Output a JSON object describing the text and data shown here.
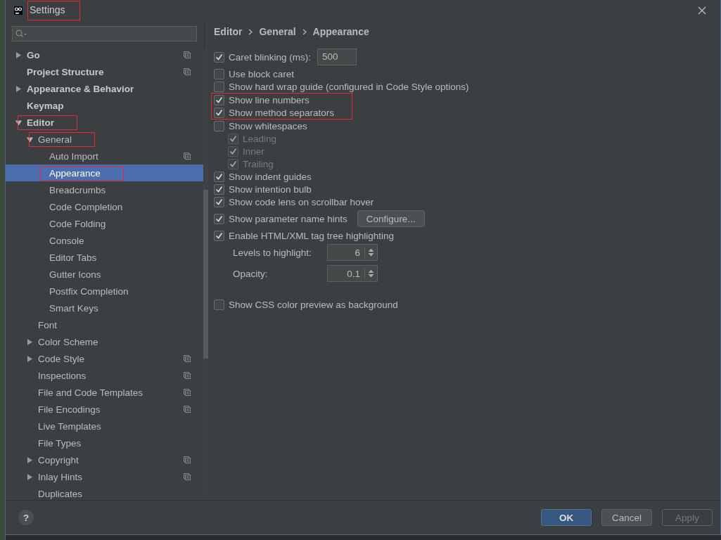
{
  "window": {
    "title": "Settings",
    "title_marked": true
  },
  "tree": [
    {
      "label": "Go",
      "expanded": false,
      "project_level": true
    },
    {
      "label": "Project Structure",
      "project_level": true
    },
    {
      "label": "Appearance & Behavior",
      "expanded": false
    },
    {
      "label": "Keymap"
    },
    {
      "label": "Editor",
      "expanded": true,
      "marked": true,
      "children": [
        {
          "label": "General",
          "expanded": true,
          "marked": true,
          "children": [
            {
              "label": "Auto Import",
              "project_level": true,
              "selected": false
            },
            {
              "label": "Appearance",
              "selected": true,
              "marked": true
            },
            {
              "label": "Breadcrumbs",
              "selected": false
            },
            {
              "label": "Code Completion",
              "selected": false
            },
            {
              "label": "Code Folding",
              "selected": false
            },
            {
              "label": "Console",
              "selected": false
            },
            {
              "label": "Editor Tabs",
              "selected": false
            },
            {
              "label": "Gutter Icons",
              "selected": false
            },
            {
              "label": "Postfix Completion",
              "selected": false
            },
            {
              "label": "Smart Keys",
              "selected": false
            }
          ]
        },
        {
          "label": "Font"
        },
        {
          "label": "Color Scheme",
          "expanded": false
        },
        {
          "label": "Code Style",
          "expanded": false,
          "project_level": true
        },
        {
          "label": "Inspections",
          "project_level": true
        },
        {
          "label": "File and Code Templates",
          "project_level": true
        },
        {
          "label": "File Encodings",
          "project_level": true
        },
        {
          "label": "Live Templates"
        },
        {
          "label": "File Types"
        },
        {
          "label": "Copyright",
          "expanded": false,
          "project_level": true
        },
        {
          "label": "Inlay Hints",
          "expanded": false,
          "project_level": true
        },
        {
          "label": "Duplicates"
        }
      ]
    }
  ],
  "breadcrumb": [
    "Editor",
    "General",
    "Appearance"
  ],
  "options": [
    {
      "kind": "checkbox-field",
      "label": "Caret blinking (ms):",
      "checked": true,
      "value": "500"
    },
    {
      "kind": "checkbox",
      "label": "Use block caret",
      "checked": false
    },
    {
      "kind": "checkbox",
      "label": "Show hard wrap guide (configured in Code Style options)",
      "checked": false
    },
    {
      "kind": "group",
      "marked": true,
      "items": [
        {
          "label": "Show line numbers",
          "checked": true
        },
        {
          "label": "Show method separators",
          "checked": true
        }
      ]
    },
    {
      "kind": "checkbox",
      "label": "Show whitespaces",
      "checked": false,
      "children": [
        {
          "kind": "checkbox",
          "label": "Leading",
          "checked": true,
          "disabled": true
        },
        {
          "kind": "checkbox",
          "label": "Inner",
          "checked": true,
          "disabled": true
        },
        {
          "kind": "checkbox",
          "label": "Trailing",
          "checked": true,
          "disabled": true
        }
      ]
    },
    {
      "kind": "checkbox",
      "label": "Show indent guides",
      "checked": true
    },
    {
      "kind": "checkbox",
      "label": "Show intention bulb",
      "checked": true
    },
    {
      "kind": "checkbox",
      "label": "Show code lens on scrollbar hover",
      "checked": true
    },
    {
      "kind": "checkbox-button",
      "label": "Show parameter name hints",
      "checked": true,
      "button": "Configure..."
    },
    {
      "kind": "checkbox",
      "label": "Enable HTML/XML tag tree highlighting",
      "checked": true,
      "children": [
        {
          "kind": "spinner",
          "label": "Levels to highlight:",
          "value": "6"
        },
        {
          "kind": "spinner",
          "label": "Opacity:",
          "value": "0.1"
        }
      ]
    },
    {
      "kind": "checkbox",
      "label": "Show CSS color preview as background",
      "checked": false,
      "separated": true
    }
  ],
  "help": "?",
  "buttons": [
    {
      "label": "OK",
      "default": true,
      "disabled": false
    },
    {
      "label": "Cancel",
      "default": false,
      "disabled": false
    },
    {
      "label": "Apply",
      "default": false,
      "disabled": true
    }
  ]
}
